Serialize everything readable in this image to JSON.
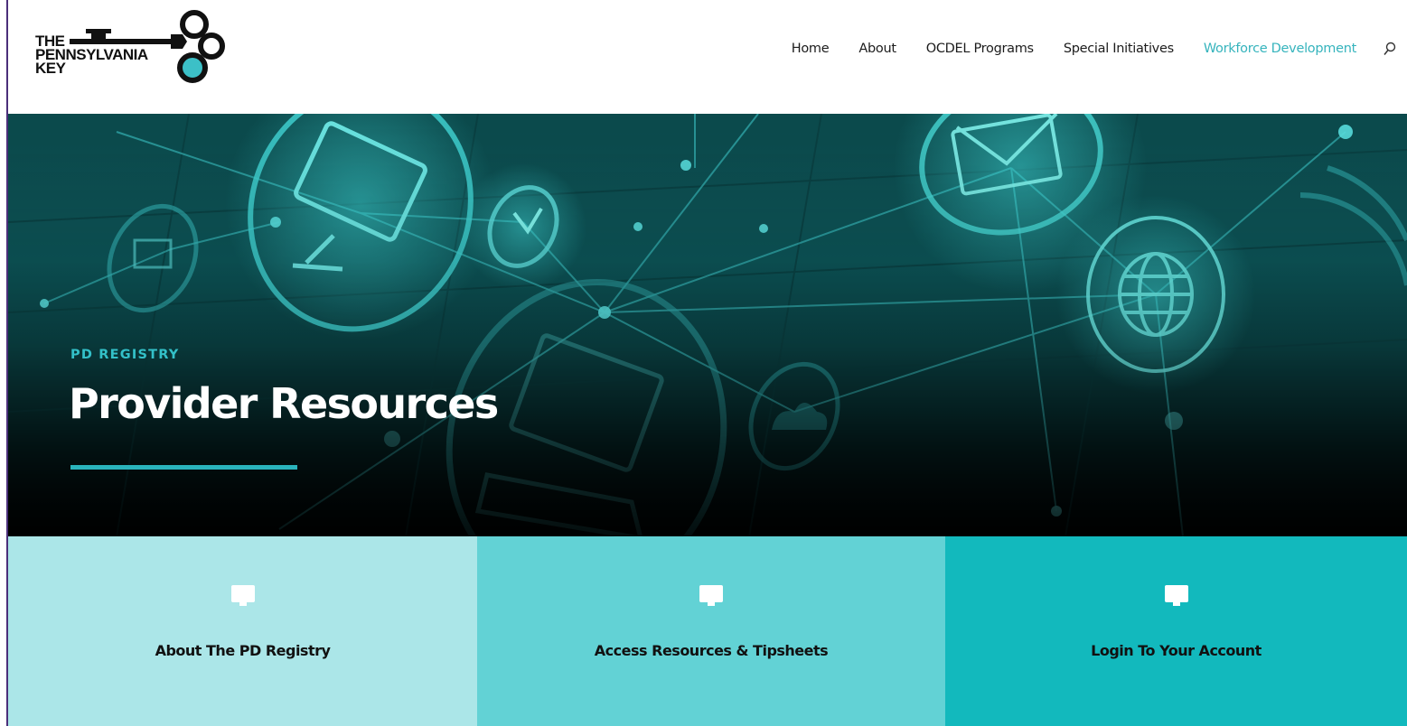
{
  "logo": {
    "line1": "THE",
    "line2": "PENNSYLVANIA",
    "line3": "KEY",
    "icon": "key-logo-icon"
  },
  "nav": {
    "items": [
      {
        "label": "Home"
      },
      {
        "label": "About"
      },
      {
        "label": "OCDEL Programs"
      },
      {
        "label": "Special Initiatives"
      },
      {
        "label": "Workforce Development",
        "active": true
      }
    ],
    "search_icon": "search-icon"
  },
  "hero": {
    "eyebrow": "PD REGISTRY",
    "title": "Provider Resources"
  },
  "cards": [
    {
      "label": "About The PD Registry",
      "icon": "monitor-icon"
    },
    {
      "label": "Access Resources & Tipsheets",
      "icon": "monitor-icon"
    },
    {
      "label": "Login To Your Account",
      "icon": "monitor-icon"
    }
  ],
  "colors": {
    "accent": "#36b4bd",
    "card1": "#abe6e8",
    "card2": "#62d2d5",
    "card3": "#12b9bd",
    "left_border": "#4b2f7a"
  }
}
